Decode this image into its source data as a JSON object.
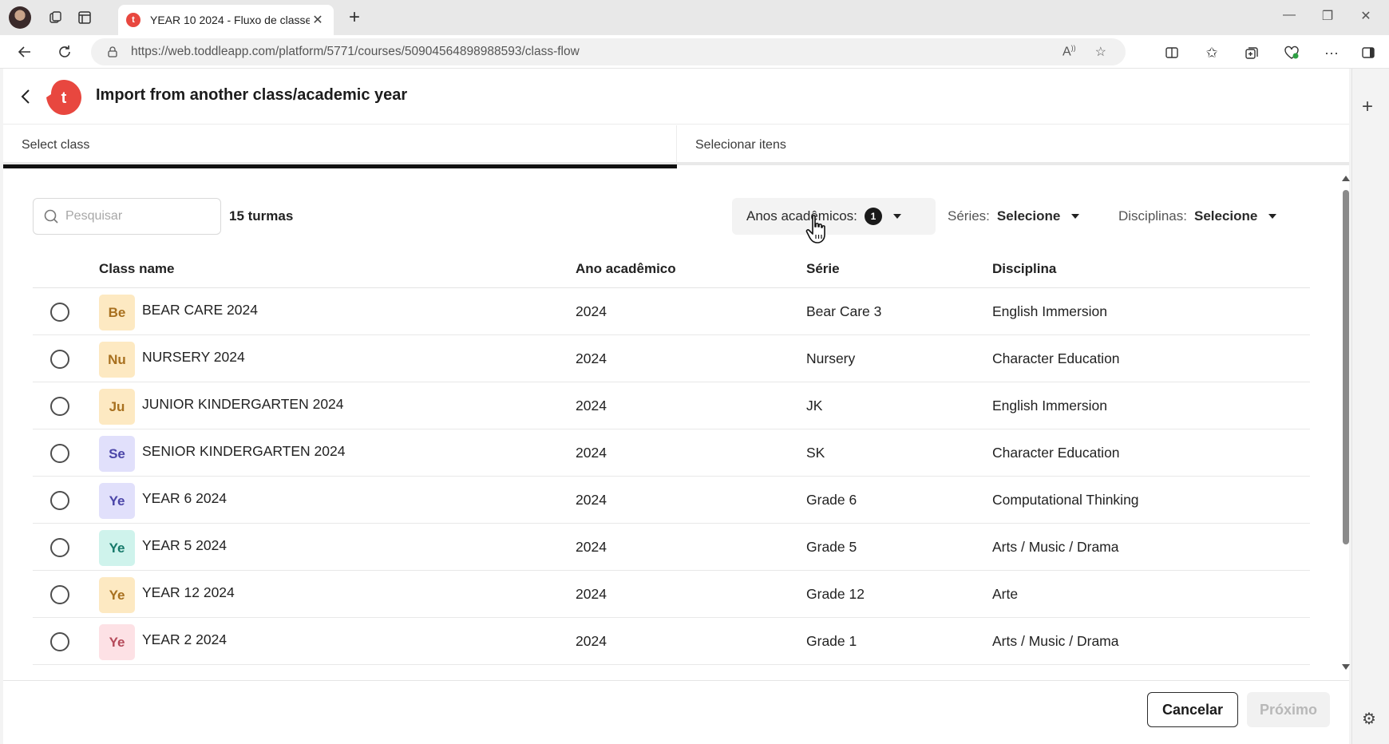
{
  "browser": {
    "tab_title": "YEAR 10 2024 - Fluxo de classe",
    "url": "https://web.toddleapp.com/platform/5771/courses/50904564898988593/class-flow"
  },
  "header": {
    "logo_letter": "t",
    "title": "Import from another class/academic year"
  },
  "steps": [
    {
      "label": "Select class",
      "active": true
    },
    {
      "label": "Selecionar itens",
      "active": false
    }
  ],
  "toolbar": {
    "search_placeholder": "Pesquisar",
    "count_label": "15 turmas",
    "filters": {
      "academic_years": {
        "label": "Anos acadêmicos:",
        "badge": "1"
      },
      "series": {
        "label": "Séries:",
        "value": "Selecione"
      },
      "disciplines": {
        "label": "Disciplinas:",
        "value": "Selecione"
      }
    }
  },
  "table": {
    "columns": [
      "Class name",
      "Ano acadêmico",
      "Série",
      "Disciplina"
    ],
    "rows": [
      {
        "abbr": "Be",
        "name": "BEAR CARE 2024",
        "year": "2024",
        "serie": "Bear Care 3",
        "discipline": "English Immersion",
        "tile_bg": "#fde9c2",
        "tile_fg": "#a8701f"
      },
      {
        "abbr": "Nu",
        "name": "NURSERY 2024",
        "year": "2024",
        "serie": "Nursery",
        "discipline": "Character Education",
        "tile_bg": "#fde9c2",
        "tile_fg": "#a8701f"
      },
      {
        "abbr": "Ju",
        "name": "JUNIOR KINDERGARTEN 2024",
        "year": "2024",
        "serie": "JK",
        "discipline": "English Immersion",
        "tile_bg": "#fde9c2",
        "tile_fg": "#a8701f"
      },
      {
        "abbr": "Se",
        "name": "SENIOR KINDERGARTEN 2024",
        "year": "2024",
        "serie": "SK",
        "discipline": "Character Education",
        "tile_bg": "#e1e0fb",
        "tile_fg": "#4b45a8"
      },
      {
        "abbr": "Ye",
        "name": "YEAR 6 2024",
        "year": "2024",
        "serie": "Grade 6",
        "discipline": "Computational Thinking",
        "tile_bg": "#e1e0fb",
        "tile_fg": "#4b45a8"
      },
      {
        "abbr": "Ye",
        "name": "YEAR 5 2024",
        "year": "2024",
        "serie": "Grade 5",
        "discipline": "Arts / Music / Drama",
        "tile_bg": "#cff3ec",
        "tile_fg": "#16796a"
      },
      {
        "abbr": "Ye",
        "name": "YEAR 12 2024",
        "year": "2024",
        "serie": "Grade 12",
        "discipline": "Arte",
        "tile_bg": "#fde9c2",
        "tile_fg": "#a8701f"
      },
      {
        "abbr": "Ye",
        "name": "YEAR 2 2024",
        "year": "2024",
        "serie": "Grade 1",
        "discipline": "Arts / Music / Drama",
        "tile_bg": "#fde1e5",
        "tile_fg": "#b54a5a"
      }
    ]
  },
  "footer": {
    "cancel_label": "Cancelar",
    "next_label": "Próximo"
  },
  "colors": {
    "brand": "#e8473f",
    "active_step": "#111111"
  }
}
